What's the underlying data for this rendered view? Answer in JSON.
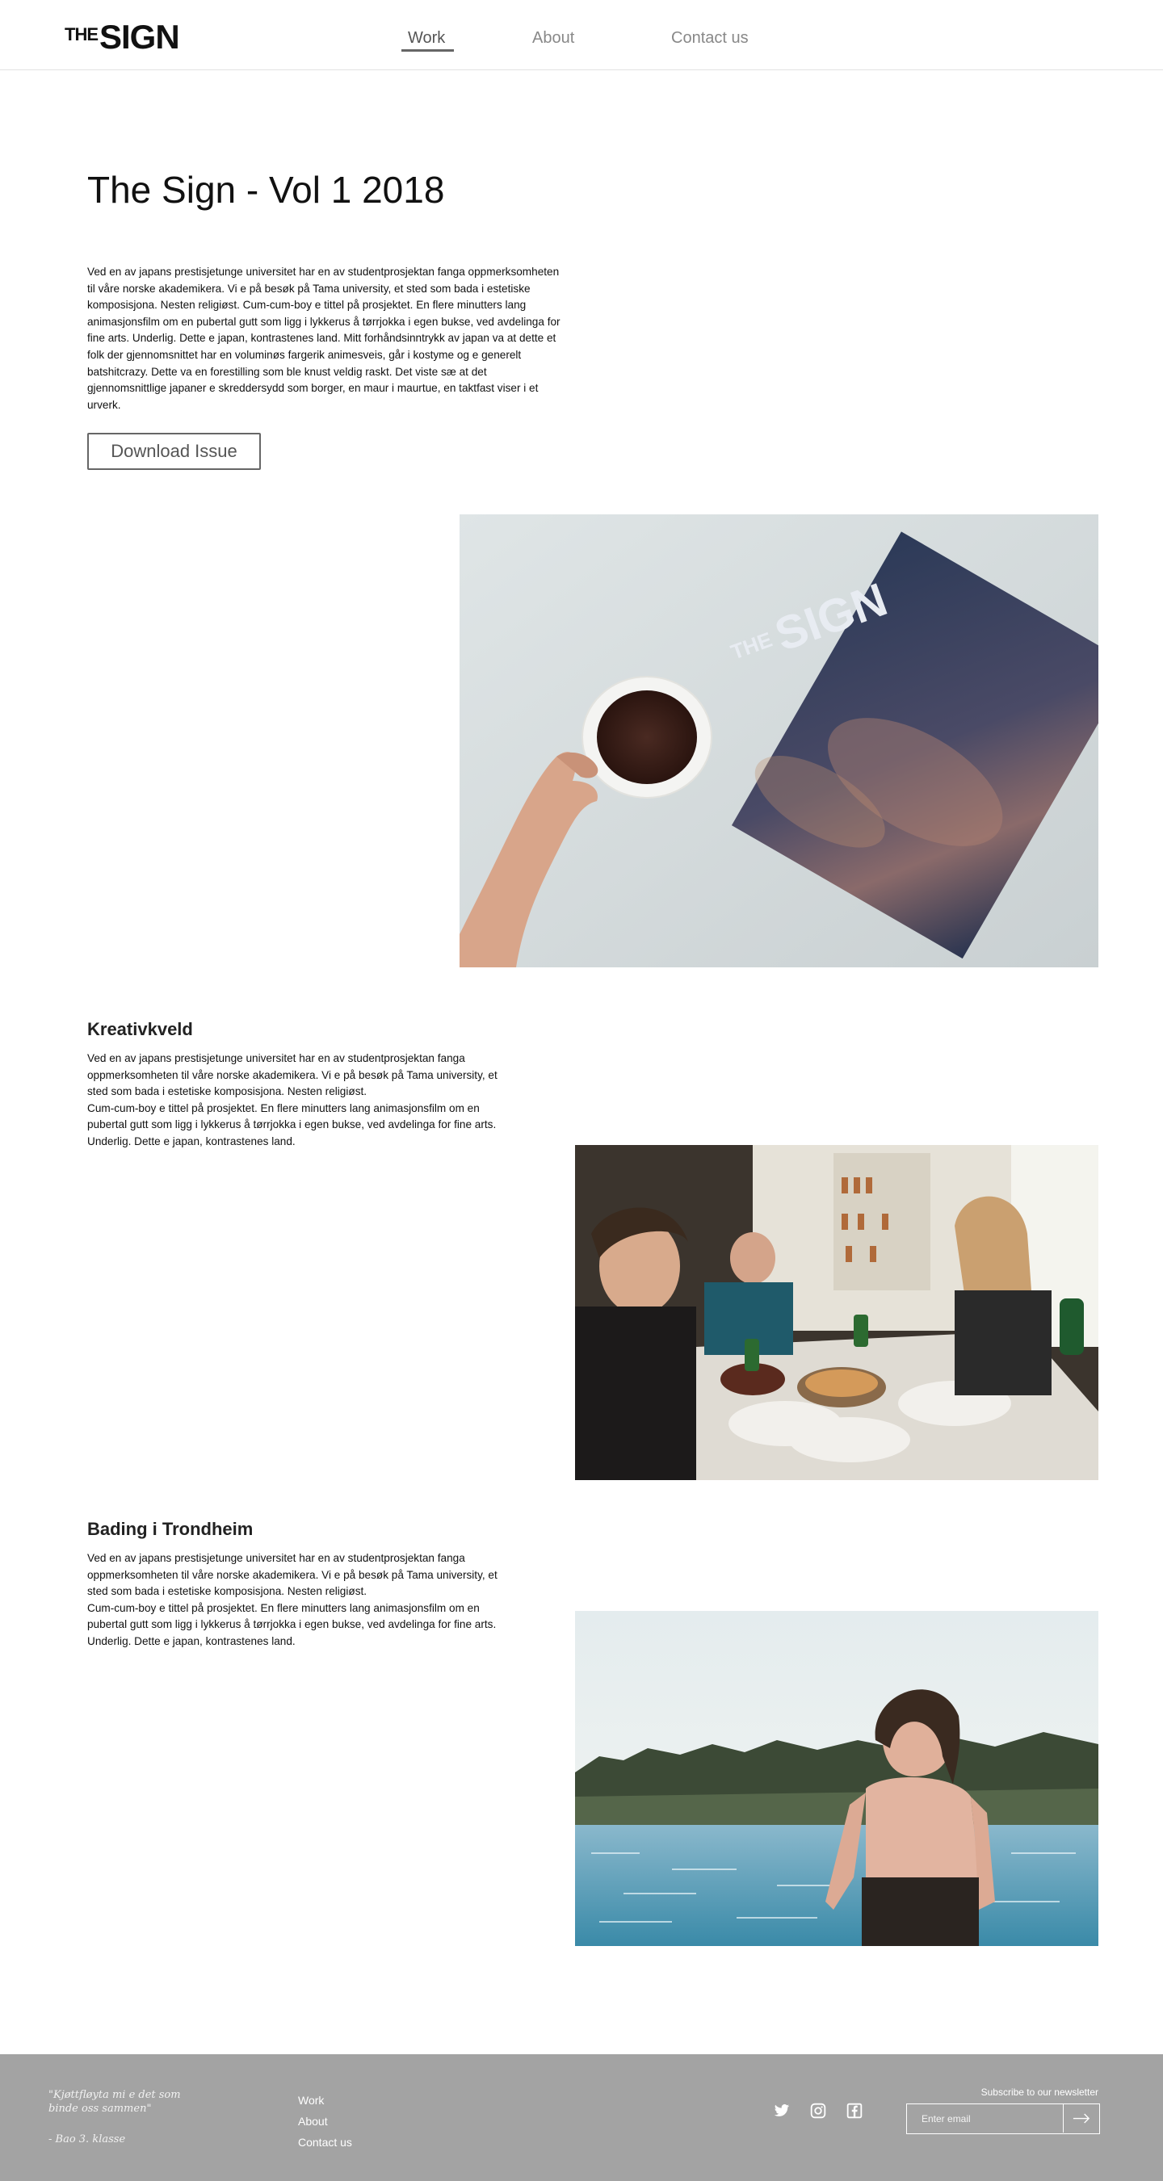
{
  "header": {
    "logo_small": "THE",
    "logo_big": "SIGN",
    "nav": [
      {
        "label": "Work",
        "active": true
      },
      {
        "label": "About",
        "active": false
      },
      {
        "label": "Contact us",
        "active": false
      }
    ]
  },
  "intro": {
    "title": "The Sign - Vol 1 2018",
    "text": "Ved en av japans prestisjetunge universitet har en av studentprosjektan fanga oppmerksomheten til våre norske akademikera. Vi e på besøk på Tama university, et sted som bada i estetiske komposisjona. Nesten religiøst.  Cum-cum-boy e tittel på prosjektet. En flere minutters lang animasjonsfilm om en pubertal gutt som ligg i lykkerus å tørrjokka i egen bukse, ved avdelinga for fine arts. Underlig. Dette e japan, kontrastenes land. Mitt forhåndsinntrykk av japan va at dette et folk der gjennomsnittet har en voluminøs fargerik animesveis, går i kostyme og e generelt batshitcrazy. Dette va en forestilling som ble knust veldig raskt. Det viste sæ at det gjennomsnittlige japaner e skreddersydd som borger, en maur i maurtue, en taktfast viser i et urverk.",
    "download_label": "Download Issue"
  },
  "magazine_image": {
    "cover_logo_small": "THE",
    "cover_logo_big": "SIGN"
  },
  "sections": [
    {
      "title": "Kreativkveld",
      "text": "Ved en av japans prestisjetunge universitet har en av studentprosjektan fanga oppmerksomheten til våre norske akademikera. Vi e på besøk på Tama university, et sted som bada i estetiske komposisjona. Nesten religiøst.\n Cum-cum-boy e tittel på prosjektet. En flere minutters lang animasjonsfilm om en pubertal gutt som ligg i lykkerus å tørrjokka i egen bukse, ved avdelinga for fine arts. Underlig. Dette e japan, kontrastenes land."
    },
    {
      "title": "Bading i Trondheim",
      "text": "Ved en av japans prestisjetunge universitet har en av studentprosjektan fanga oppmerksomheten til våre norske akademikera. Vi e på besøk på Tama university, et sted som bada i estetiske komposisjona. Nesten religiøst.\n Cum-cum-boy e tittel på prosjektet. En flere minutters lang animasjonsfilm om en pubertal gutt som ligg i lykkerus å tørrjokka i egen bukse, ved avdelinga for fine arts. Underlig. Dette e japan, kontrastenes land."
    }
  ],
  "footer": {
    "quote": "\"Kjøttfløyta mi e det som binde oss sammen\"",
    "quote_author": "- Bao 3. klasse",
    "nav": [
      "Work",
      "About",
      "Contact us"
    ],
    "social": [
      "twitter-icon",
      "instagram-icon",
      "facebook-icon"
    ],
    "newsletter_label": "Subscribe to our newsletter",
    "email_placeholder": "Enter email"
  },
  "colors": {
    "footer_bg": "#a3a3a3",
    "text": "#111111",
    "nav_inactive": "#888888"
  }
}
